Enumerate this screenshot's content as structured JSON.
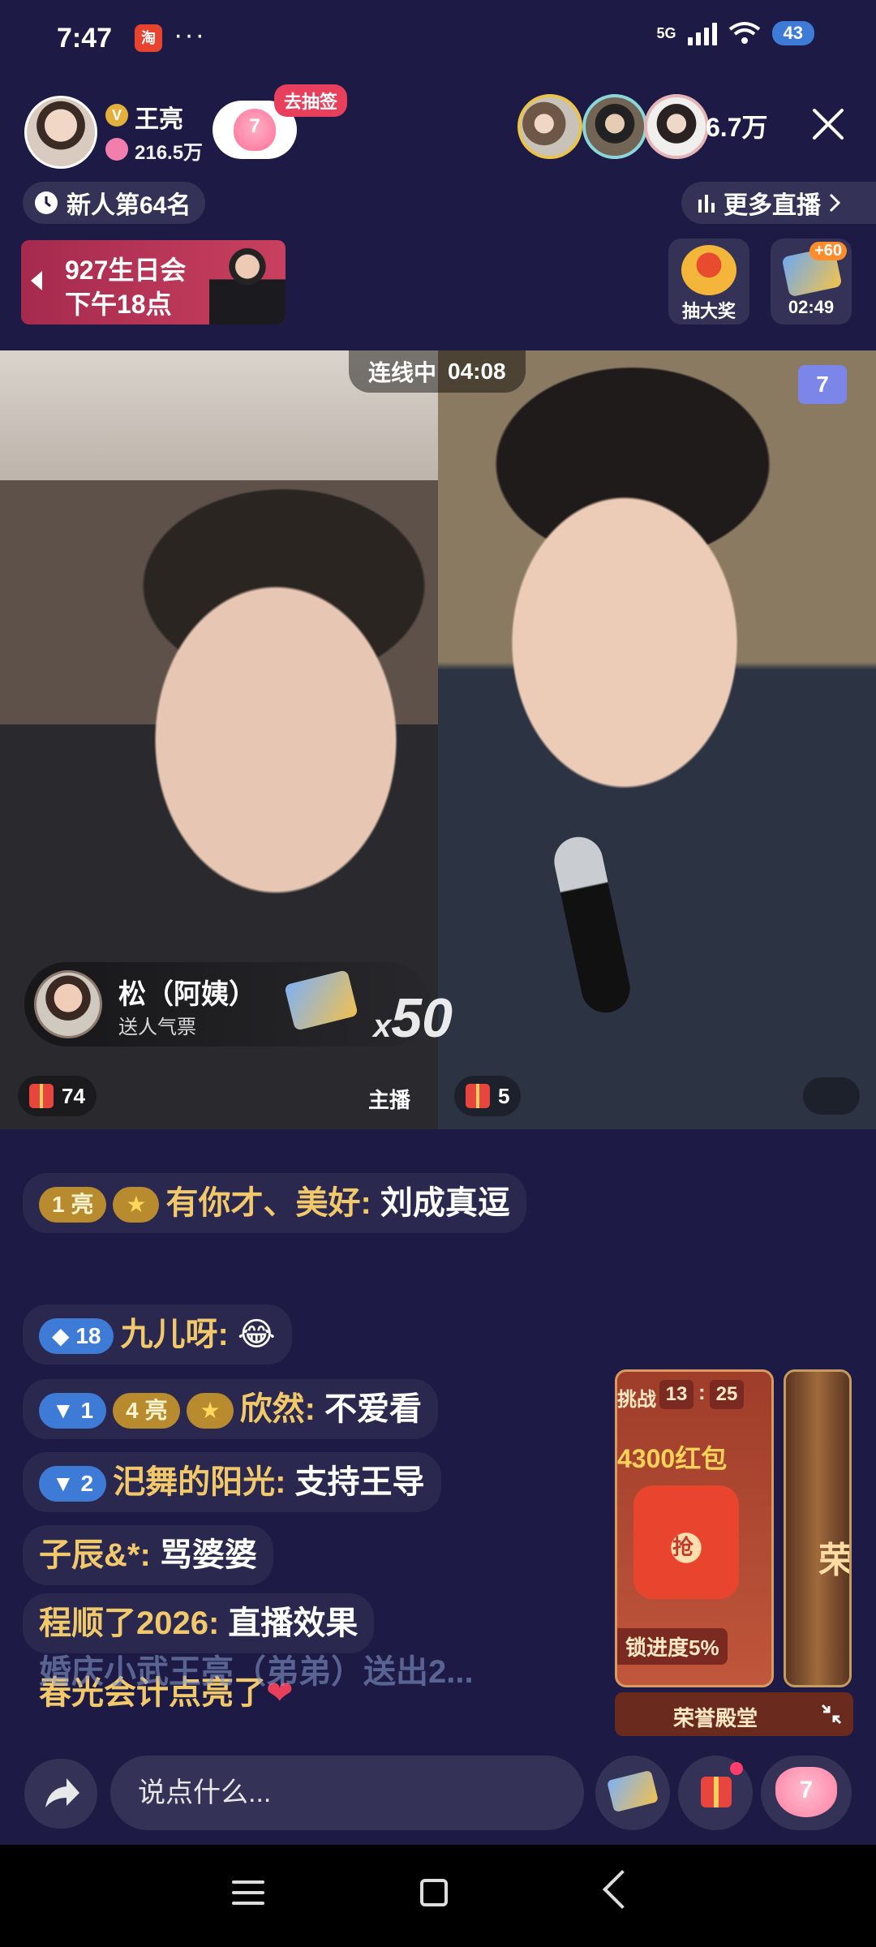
{
  "status_bar": {
    "time": "7:47",
    "app_icon_text": "淘",
    "more": "···",
    "network": "5G",
    "battery": "43"
  },
  "header": {
    "host_name": "王亮",
    "host_likes": "216.5万",
    "heart_pill_count": "7",
    "lottery_badge": "去抽签",
    "viewer_count": "6.7万",
    "rank_text": "新人第64名",
    "more_live_text": "更多直播"
  },
  "event_banner": {
    "line1": "927生日会",
    "line2": "下午18点"
  },
  "widgets": {
    "lucky_label": "抽大奖",
    "ticket_plus": "+60",
    "ticket_timer": "02:49"
  },
  "video": {
    "link_status": "连线中",
    "link_time": "04:08",
    "level_badge": "7",
    "gift_sender": "松（阿姨）",
    "gift_desc": "送人气票",
    "gift_multiplier": "x",
    "gift_count": "50",
    "left_gifts": "74",
    "right_gifts": "5",
    "anchor_label": "主播"
  },
  "chat": [
    {
      "badge1": "亮",
      "badge1_level": "1",
      "user": "有你才、美好",
      "text": "刘成真逗"
    },
    {
      "badge1": "18",
      "user": "九儿呀",
      "text": "😂"
    },
    {
      "badge1": "1",
      "badge2": "亮",
      "badge2_level": "4",
      "user": "欣然",
      "text": "不爱看"
    },
    {
      "badge1": "2",
      "user": "汜舞的阳光",
      "text": "支持王导"
    },
    {
      "user": "子辰&*",
      "text": "骂婆婆"
    },
    {
      "user": "程顺了2026",
      "text": "直播效果"
    },
    {
      "ghost": "婚庆小武王亮（弟弟）送出2...",
      "user": "春光会计点亮了",
      "text": "❤"
    }
  ],
  "promo": {
    "title": "挑战",
    "time_h": "13",
    "time_sep": ":",
    "time_m": "25",
    "amount": "4300红包",
    "envelope_label": "抢",
    "progress": "锁进度5%",
    "card2_text": "荣",
    "honor_label": "荣誉殿堂"
  },
  "bottom_bar": {
    "placeholder": "说点什么...",
    "like_count": "7"
  },
  "colors": {
    "background": "#1d1b45",
    "accent_pink": "#e8405c",
    "username_gold": "#f2c96a",
    "badge_blue": "#3d7bd6"
  }
}
